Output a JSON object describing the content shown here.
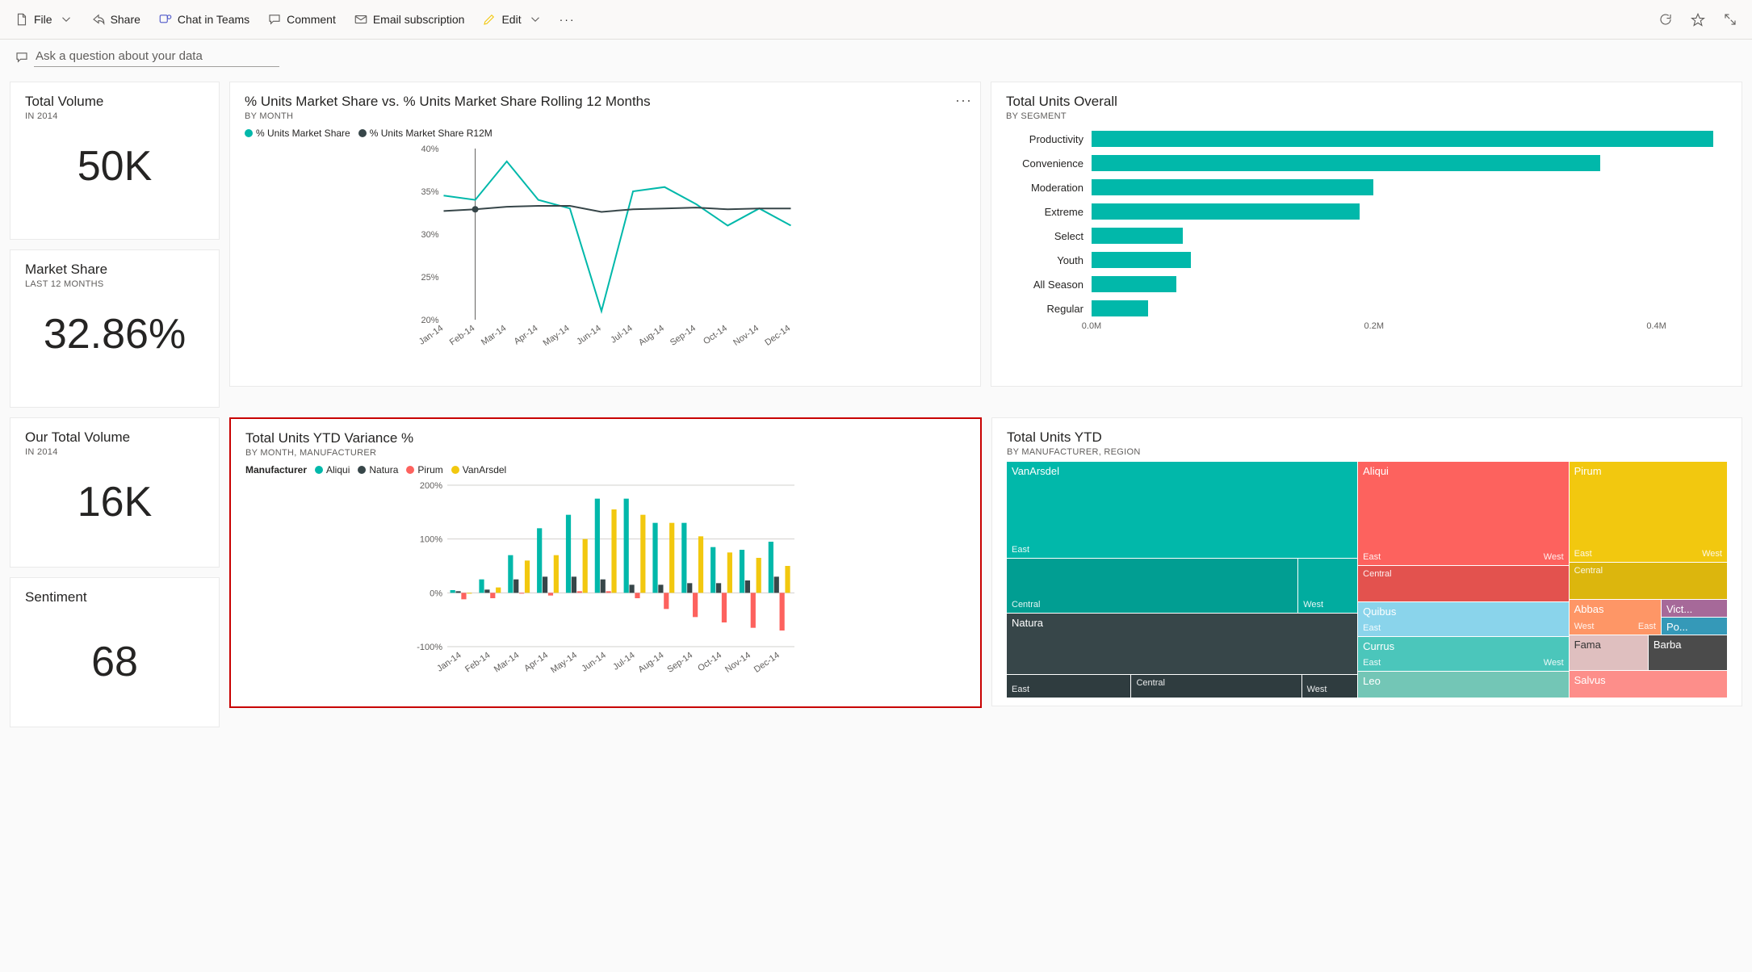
{
  "toolbar": {
    "file": "File",
    "share": "Share",
    "chat": "Chat in Teams",
    "comment": "Comment",
    "email": "Email subscription",
    "edit": "Edit"
  },
  "qna": {
    "placeholder": "Ask a question about your data"
  },
  "cards": {
    "total_volume": {
      "title": "Total Volume",
      "sub": "IN 2014",
      "value": "50K"
    },
    "market_share": {
      "title": "Market Share",
      "sub": "LAST 12 MONTHS",
      "value": "32.86%"
    },
    "our_total_volume": {
      "title": "Our Total Volume",
      "sub": "IN 2014",
      "value": "16K"
    },
    "sentiment": {
      "title": "Sentiment",
      "value": "68"
    }
  },
  "line_chart_title": {
    "title": "% Units Market Share vs. % Units Market Share Rolling 12 Months",
    "sub": "BY MONTH",
    "legend_a": "% Units Market Share",
    "legend_b": "% Units Market Share R12M"
  },
  "segment_chart_title": {
    "title": "Total Units Overall",
    "sub": "BY SEGMENT"
  },
  "variance_chart_title": {
    "title": "Total Units YTD Variance %",
    "sub": "BY MONTH, MANUFACTURER",
    "legend_title": "Manufacturer",
    "l1": "Aliqui",
    "l2": "Natura",
    "l3": "Pirum",
    "l4": "VanArsdel"
  },
  "treemap_title": {
    "title": "Total Units YTD",
    "sub": "BY MANUFACTURER, REGION"
  },
  "treemap_labels": {
    "vanarsdel": "VanArsdel",
    "aliqui": "Aliqui",
    "pirum": "Pirum",
    "natura": "Natura",
    "quibus": "Quibus",
    "abbas": "Abbas",
    "vict": "Vict...",
    "po": "Po...",
    "currus": "Currus",
    "fama": "Fama",
    "barba": "Barba",
    "leo": "Leo",
    "salvus": "Salvus",
    "east": "East",
    "west": "West",
    "central": "Central"
  },
  "chart_data": [
    {
      "id": "market_share_line",
      "type": "line",
      "title": "% Units Market Share vs. % Units Market Share Rolling 12 Months",
      "xlabel": "Month",
      "ylabel": "%",
      "x": [
        "Jan-14",
        "Feb-14",
        "Mar-14",
        "Apr-14",
        "May-14",
        "Jun-14",
        "Jul-14",
        "Aug-14",
        "Sep-14",
        "Oct-14",
        "Nov-14",
        "Dec-14"
      ],
      "ylim": [
        20,
        40
      ],
      "series": [
        {
          "name": "% Units Market Share",
          "color": "#01b8aa",
          "values": [
            34.5,
            34,
            38.5,
            34,
            33,
            21,
            35,
            35.5,
            33.5,
            31,
            33,
            31
          ]
        },
        {
          "name": "% Units Market Share R12M",
          "color": "#374649",
          "values": [
            32.7,
            32.9,
            33.2,
            33.3,
            33.3,
            32.6,
            32.9,
            33.0,
            33.1,
            32.9,
            33.0,
            33.0
          ]
        }
      ]
    },
    {
      "id": "total_units_segment",
      "type": "bar",
      "orientation": "horizontal",
      "title": "Total Units Overall",
      "categories": [
        "Productivity",
        "Convenience",
        "Moderation",
        "Extreme",
        "Select",
        "Youth",
        "All Season",
        "Regular"
      ],
      "values_m": [
        0.44,
        0.36,
        0.2,
        0.19,
        0.065,
        0.07,
        0.06,
        0.04
      ],
      "xlabel": "Units (M)",
      "xlim": [
        0,
        0.45
      ],
      "xticks": [
        "0.0M",
        "0.2M",
        "0.4M"
      ]
    },
    {
      "id": "ytd_variance",
      "type": "bar",
      "title": "Total Units YTD Variance %",
      "x": [
        "Jan-14",
        "Feb-14",
        "Mar-14",
        "Apr-14",
        "May-14",
        "Jun-14",
        "Jul-14",
        "Aug-14",
        "Sep-14",
        "Oct-14",
        "Nov-14",
        "Dec-14"
      ],
      "ylim": [
        -100,
        200
      ],
      "series": [
        {
          "name": "Aliqui",
          "color": "#01b8aa",
          "values": [
            5,
            25,
            70,
            120,
            145,
            175,
            175,
            130,
            130,
            85,
            80,
            95,
            85
          ]
        },
        {
          "name": "Natura",
          "color": "#374649",
          "values": [
            3,
            6,
            25,
            30,
            30,
            25,
            15,
            15,
            18,
            18,
            23,
            30,
            25
          ]
        },
        {
          "name": "Pirum",
          "color": "#fd625e",
          "values": [
            -12,
            -10,
            0,
            -5,
            3,
            3,
            -10,
            -30,
            -45,
            -55,
            -65,
            -70,
            -80
          ]
        },
        {
          "name": "VanArsdel",
          "color": "#f2c80f",
          "values": [
            0,
            10,
            60,
            70,
            100,
            155,
            145,
            130,
            105,
            75,
            65,
            50,
            55
          ]
        }
      ]
    },
    {
      "id": "treemap",
      "type": "treemap",
      "title": "Total Units YTD by Manufacturer, Region",
      "note": "relative areas approximate; exact values not displayed on screen",
      "nodes": [
        {
          "name": "VanArsdel",
          "color": "#01b8aa",
          "children": [
            "East",
            "Central",
            "West"
          ]
        },
        {
          "name": "Aliqui",
          "color": "#fd625e",
          "children": [
            "East",
            "West",
            "Central"
          ]
        },
        {
          "name": "Pirum",
          "color": "#f2c80f",
          "children": [
            "East",
            "West",
            "Central"
          ]
        },
        {
          "name": "Natura",
          "color": "#374649",
          "children": [
            "East",
            "Central",
            "West"
          ]
        },
        {
          "name": "Quibus",
          "color": "#8ad4eb",
          "children": [
            "East"
          ]
        },
        {
          "name": "Abbas",
          "color": "#fe9666",
          "children": [
            "West",
            "East"
          ]
        },
        {
          "name": "Vict...",
          "color": "#a66999",
          "children": []
        },
        {
          "name": "Po...",
          "color": "#3599b8",
          "children": []
        },
        {
          "name": "Currus",
          "color": "#01b8aa",
          "children": [
            "East",
            "West"
          ]
        },
        {
          "name": "Fama",
          "color": "#dfbfbf",
          "children": []
        },
        {
          "name": "Barba",
          "color": "#4b4b4b",
          "children": []
        },
        {
          "name": "Leo",
          "color": "#73c6b6",
          "children": []
        },
        {
          "name": "Salvus",
          "color": "#fd625e",
          "children": []
        }
      ]
    }
  ]
}
